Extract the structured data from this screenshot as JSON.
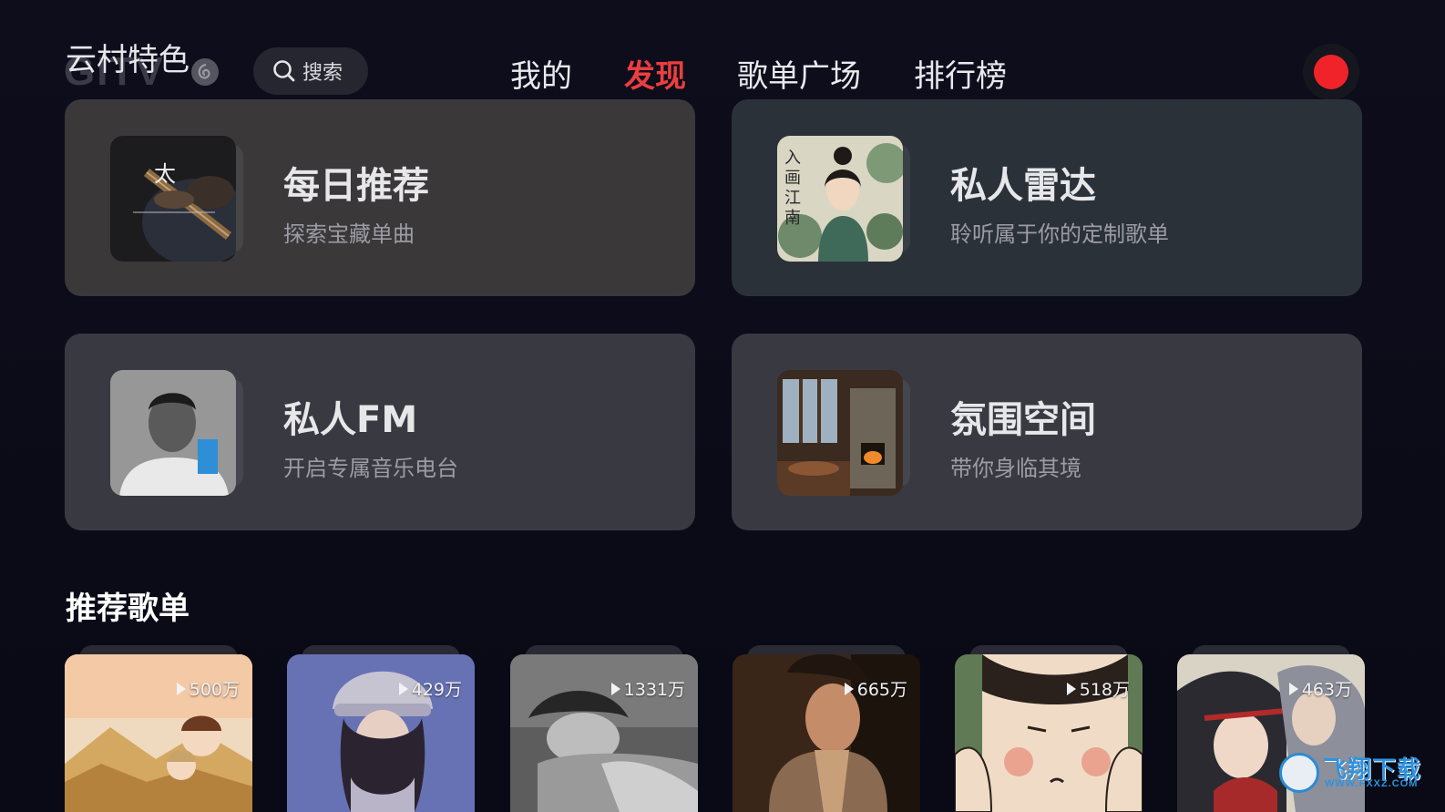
{
  "header": {
    "brand_title": "云村特色",
    "brand_ghost": "GITV",
    "search_label": "搜索",
    "tabs": [
      {
        "label": "我的",
        "active": false
      },
      {
        "label": "发现",
        "active": true
      },
      {
        "label": "歌单广场",
        "active": false
      },
      {
        "label": "排行榜",
        "active": false
      }
    ],
    "accent_color": "#ec3e3e"
  },
  "feature_cards": [
    {
      "title": "每日推荐",
      "subtitle": "探索宝藏单曲",
      "icon": "guitar-album-cover"
    },
    {
      "title": "私人雷达",
      "subtitle": "聆听属于你的定制歌单",
      "icon": "ink-painting-album-cover"
    },
    {
      "title": "私人FM",
      "subtitle": "开启专属音乐电台",
      "icon": "portrait-album-cover"
    },
    {
      "title": "氛围空间",
      "subtitle": "带你身临其境",
      "icon": "cozy-room-album-cover"
    }
  ],
  "recommended": {
    "title": "推荐歌单",
    "playlists": [
      {
        "play_count": "500万",
        "icon": "cartoon-couple-cover"
      },
      {
        "play_count": "429万",
        "icon": "winter-girl-cover"
      },
      {
        "play_count": "1331万",
        "icon": "sleeping-girl-cover"
      },
      {
        "play_count": "665万",
        "icon": "woman-portrait-cover"
      },
      {
        "play_count": "518万",
        "icon": "cartoon-face-cover"
      },
      {
        "play_count": "463万",
        "icon": "anime-characters-cover"
      }
    ]
  },
  "watermark": {
    "text": "飞翔下载",
    "sub": "WWW.FXXZ.COM"
  }
}
